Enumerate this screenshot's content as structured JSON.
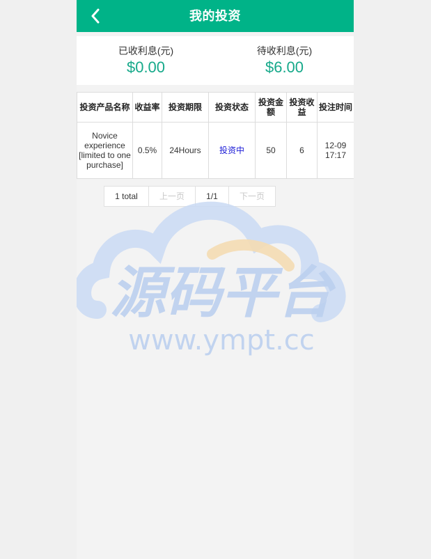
{
  "header": {
    "title": "我的投资",
    "back_icon": "chevron-left-icon"
  },
  "summary": {
    "received_label": "已收利息(元)",
    "received_value": "$0.00",
    "pending_label": "待收利息(元)",
    "pending_value": "$6.00"
  },
  "table": {
    "columns": [
      "投资产品名称",
      "收益率",
      "投资期限",
      "投资状态",
      "投资金额",
      "投资收益",
      "投注时间"
    ],
    "rows": [
      {
        "product": "Novice experience [limited to one purchase]",
        "rate": "0.5%",
        "term": "24Hours",
        "status": "投资中",
        "amount": "50",
        "profit": "6",
        "time": "12-09 17:17"
      }
    ]
  },
  "pager": {
    "total": "1 total",
    "prev": "上一页",
    "page": "1/1",
    "next": "下一页"
  },
  "watermark": {
    "text": "源码平台",
    "url": "www.ympt.cc"
  },
  "colors": {
    "accent": "#00b388",
    "value_green": "#16a98a",
    "status_blue": "#1a1ad6"
  }
}
